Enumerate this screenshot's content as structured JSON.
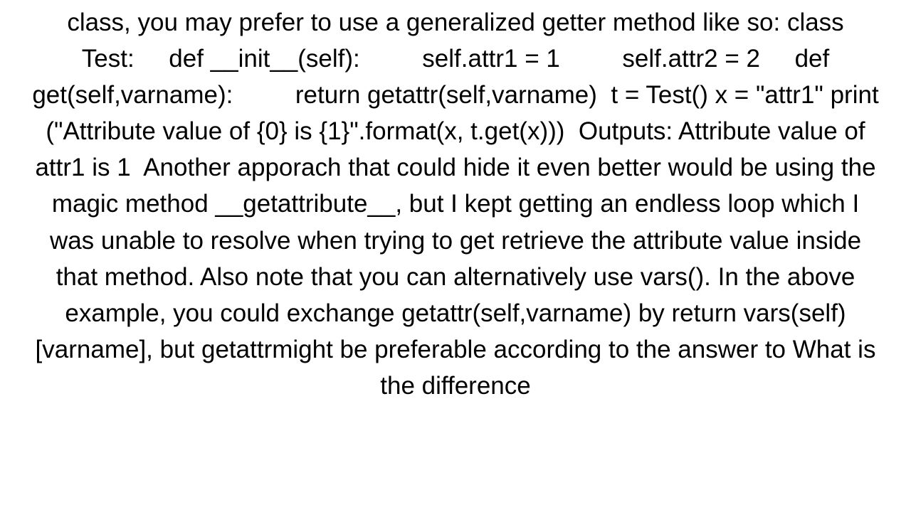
{
  "document": {
    "body_text": "class, you may prefer to use a generalized getter method like so: class Test:     def __init__(self):         self.attr1 = 1         self.attr2 = 2     def get(self,varname):         return getattr(self,varname)  t = Test() x = \"attr1\" print (\"Attribute value of {0} is {1}\".format(x, t.get(x)))  Outputs: Attribute value of attr1 is 1  Another apporach that could hide it even better would be using the magic method __getattribute__, but I kept getting an endless loop which I was unable to resolve when trying to get retrieve the attribute value inside that method. Also note that you can alternatively use vars(). In the above example, you could exchange getattr(self,varname) by return vars(self)[varname], but getattrmight be preferable according to the answer to What is the difference"
  }
}
